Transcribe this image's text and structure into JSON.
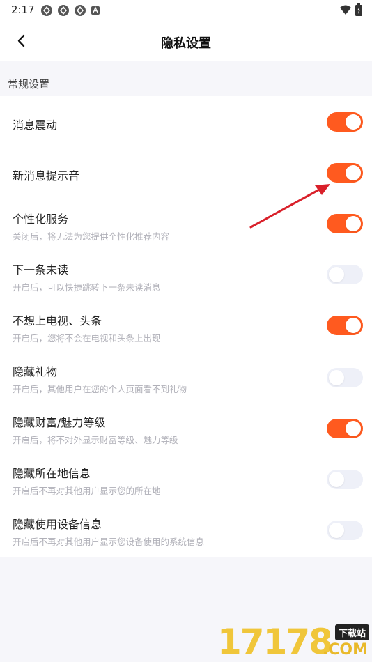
{
  "status_bar": {
    "time": "2:17"
  },
  "header": {
    "title": "隐私设置"
  },
  "section": {
    "title": "常规设置"
  },
  "settings": [
    {
      "title": "消息震动",
      "desc": "",
      "on": true
    },
    {
      "title": "新消息提示音",
      "desc": "",
      "on": true
    },
    {
      "title": "个性化服务",
      "desc": "关闭后，将无法为您提供个性化推荐内容",
      "on": true
    },
    {
      "title": "下一条未读",
      "desc": "开启后，可以快捷跳转下一条未读消息",
      "on": false
    },
    {
      "title": "不想上电视、头条",
      "desc": "开启后，您将不会在电视和头条上出现",
      "on": true
    },
    {
      "title": "隐藏礼物",
      "desc": "开启后，其他用户在您的个人页面看不到礼物",
      "on": false
    },
    {
      "title": "隐藏财富/魅力等级",
      "desc": "开启后，将不对外显示财富等级、魅力等级",
      "on": true
    },
    {
      "title": "隐藏所在地信息",
      "desc": "开启后不再对其他用户显示您的所在地",
      "on": false
    },
    {
      "title": "隐藏使用设备信息",
      "desc": "开启后不再对其他用户显示您设备使用的系统信息",
      "on": false
    }
  ],
  "watermark": {
    "number": "17178",
    "badge": "下载站",
    "domain": ".COM"
  },
  "colors": {
    "toggle_on": "#ff5a1f",
    "toggle_off": "#eef0f8",
    "annotation_arrow": "#d9202a"
  },
  "icons": [
    "back-arrow-icon",
    "wifi-icon",
    "battery-icon",
    "notification-icon",
    "a-icon"
  ]
}
